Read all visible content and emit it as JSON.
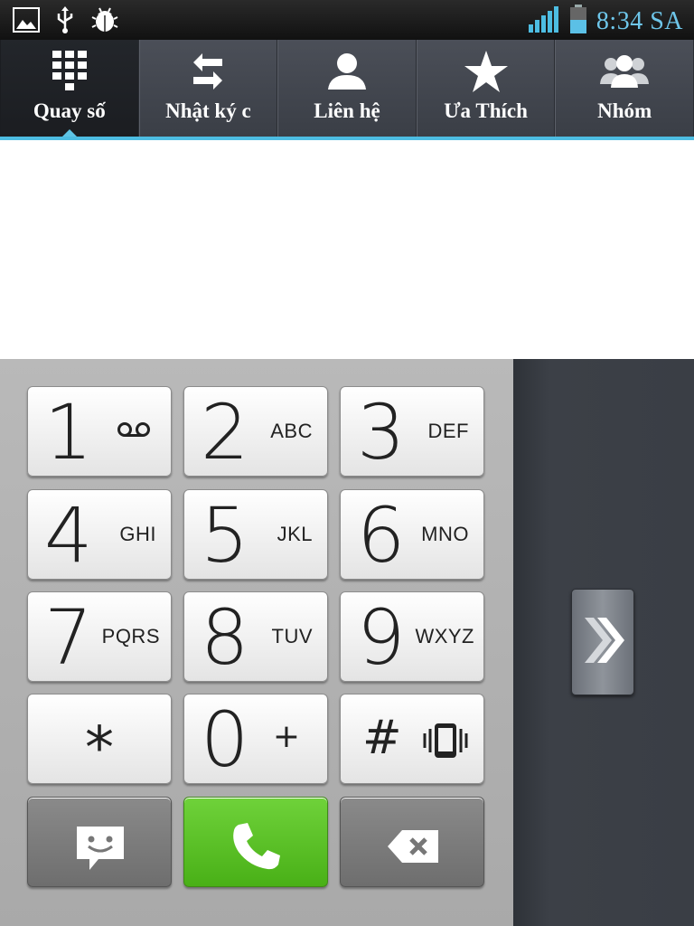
{
  "status_bar": {
    "time": "8:34 SA",
    "left_icons": [
      "gallery-icon",
      "usb-icon",
      "debug-bug-icon"
    ],
    "right_icons": [
      "signal-icon",
      "battery-icon"
    ]
  },
  "tabs": [
    {
      "label": "Quay số",
      "icon": "dialpad-icon",
      "active": true
    },
    {
      "label": "Nhật ký c",
      "icon": "call-log-arrows-icon",
      "active": false
    },
    {
      "label": "Liên hệ",
      "icon": "contact-person-icon",
      "active": false
    },
    {
      "label": "Ưa Thích",
      "icon": "star-icon",
      "active": false
    },
    {
      "label": "Nhóm",
      "icon": "group-icon",
      "active": false
    }
  ],
  "dialed_number": "",
  "keys": [
    {
      "digit": "1",
      "letters": "",
      "extra_icon": "voicemail-icon"
    },
    {
      "digit": "2",
      "letters": "ABC"
    },
    {
      "digit": "3",
      "letters": "DEF"
    },
    {
      "digit": "4",
      "letters": "GHI"
    },
    {
      "digit": "5",
      "letters": "JKL"
    },
    {
      "digit": "6",
      "letters": "MNO"
    },
    {
      "digit": "7",
      "letters": "PQRS"
    },
    {
      "digit": "8",
      "letters": "TUV"
    },
    {
      "digit": "9",
      "letters": "WXYZ"
    },
    {
      "digit": "*",
      "letters": ""
    },
    {
      "digit": "0",
      "letters": "+"
    },
    {
      "digit": "#",
      "letters": "",
      "extra_icon": "vibrate-icon"
    }
  ],
  "actions": {
    "message_icon": "message-smiley-icon",
    "call_icon": "phone-icon",
    "delete_icon": "backspace-icon"
  },
  "side_panel": {
    "handle_icon": "double-chevron-right-icon"
  },
  "colors": {
    "accent": "#4dbde2",
    "call_green": "#5cc527",
    "time_color": "#6ec6ea"
  }
}
